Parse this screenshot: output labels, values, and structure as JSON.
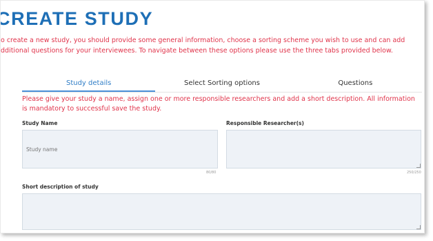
{
  "header": {
    "title": "CREATE STUDY",
    "intro_line1": "o create a new study, you should provide some general information, choose a sorting scheme you wish to use and can add",
    "intro_line2": "dditional questions for your interviewees. To navigate between these options please use the three tabs provided below."
  },
  "tabs": [
    {
      "label": "Study details",
      "active": true
    },
    {
      "label": "Select Sorting options",
      "active": false
    },
    {
      "label": "Questions",
      "active": false
    }
  ],
  "notice": "Please give your study a name, assign one or more responsible researchers and add a short description. All information is mandatory to successful save the study.",
  "form": {
    "study_name": {
      "label": "Study Name",
      "value": "",
      "placeholder": "Study name",
      "counter": "80/80"
    },
    "researchers": {
      "label": "Responsible Researcher(s)",
      "value": "",
      "counter": "250/250"
    },
    "description": {
      "label": "Short description of study",
      "value": ""
    }
  },
  "colors": {
    "title": "#1e6fb6",
    "warning": "#e0334a",
    "active_tab": "#2f7dc6",
    "field_bg": "#eef2f7"
  }
}
